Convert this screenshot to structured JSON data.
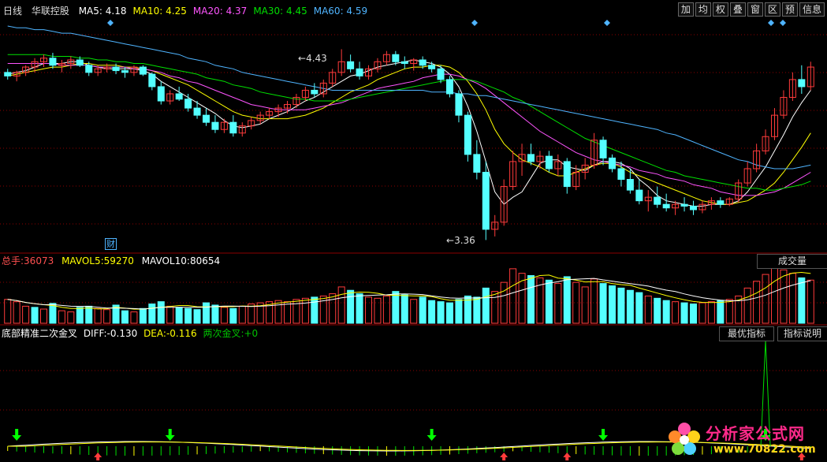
{
  "header": {
    "period": "日线",
    "stock_name": "华联控股",
    "ma": [
      {
        "label": "MA5:",
        "value": "4.18",
        "color": "#ffffff"
      },
      {
        "label": "MA10:",
        "value": "4.25",
        "color": "#ffff00"
      },
      {
        "label": "MA20:",
        "value": "4.37",
        "color": "#ff55ff"
      },
      {
        "label": "MA30:",
        "value": "4.45",
        "color": "#00e000"
      },
      {
        "label": "MA60:",
        "value": "4.59",
        "color": "#4fb4ff"
      }
    ],
    "buttons": [
      "加",
      "均",
      "权",
      "叠",
      "窗",
      "区",
      "预",
      "信息"
    ]
  },
  "annotations": {
    "high": "4.43",
    "low": "3.36",
    "fin_marker": "财"
  },
  "volume": {
    "label_total": "总手:",
    "total": "36073",
    "label_mavol5": "MAVOL5:",
    "mavol5": "59270",
    "label_mavol10": "MAVOL10:",
    "mavol10": "80654",
    "dropdown": "成交量"
  },
  "indicator": {
    "name": "底部精准二次金叉",
    "label_diff": "DIFF:",
    "diff": "-0.130",
    "label_dea": "DEA:",
    "dea": "-0.116",
    "label_cross": "两次金叉:",
    "cross": "+0",
    "btn_best": "最优指标",
    "btn_help": "指标说明"
  },
  "watermark": {
    "cn": "分析家公式网",
    "url": "www.70822.com"
  },
  "colors": {
    "up": "#ff3b3b",
    "down": "#54ffff",
    "bg": "#000000",
    "grid": "#8b0000"
  },
  "chart_data": {
    "type": "candlestick",
    "price_high": 4.43,
    "price_low": 3.36,
    "price_axis": [
      3.3,
      4.6
    ],
    "ohlc": [
      [
        4.3,
        4.32,
        4.26,
        4.28
      ],
      [
        4.28,
        4.31,
        4.25,
        4.3
      ],
      [
        4.3,
        4.34,
        4.28,
        4.33
      ],
      [
        4.33,
        4.38,
        4.3,
        4.36
      ],
      [
        4.36,
        4.4,
        4.33,
        4.38
      ],
      [
        4.38,
        4.41,
        4.32,
        4.34
      ],
      [
        4.34,
        4.37,
        4.3,
        4.35
      ],
      [
        4.35,
        4.39,
        4.32,
        4.37
      ],
      [
        4.37,
        4.39,
        4.33,
        4.34
      ],
      [
        4.34,
        4.36,
        4.28,
        4.3
      ],
      [
        4.3,
        4.34,
        4.28,
        4.32
      ],
      [
        4.32,
        4.35,
        4.3,
        4.33
      ],
      [
        4.33,
        4.35,
        4.29,
        4.31
      ],
      [
        4.31,
        4.33,
        4.27,
        4.3
      ],
      [
        4.3,
        4.34,
        4.28,
        4.33
      ],
      [
        4.33,
        4.34,
        4.28,
        4.29
      ],
      [
        4.29,
        4.3,
        4.2,
        4.22
      ],
      [
        4.22,
        4.25,
        4.12,
        4.14
      ],
      [
        4.14,
        4.2,
        4.12,
        4.18
      ],
      [
        4.18,
        4.22,
        4.14,
        4.15
      ],
      [
        4.15,
        4.18,
        4.08,
        4.1
      ],
      [
        4.1,
        4.14,
        4.04,
        4.06
      ],
      [
        4.06,
        4.1,
        4.0,
        4.02
      ],
      [
        4.02,
        4.06,
        3.96,
        3.98
      ],
      [
        3.98,
        4.04,
        3.96,
        4.02
      ],
      [
        4.02,
        4.06,
        3.94,
        3.96
      ],
      [
        3.96,
        4.02,
        3.94,
        4.0
      ],
      [
        4.0,
        4.05,
        3.98,
        4.03
      ],
      [
        4.03,
        4.08,
        4.01,
        4.06
      ],
      [
        4.06,
        4.1,
        4.04,
        4.08
      ],
      [
        4.08,
        4.12,
        4.05,
        4.1
      ],
      [
        4.1,
        4.14,
        4.07,
        4.12
      ],
      [
        4.12,
        4.18,
        4.1,
        4.16
      ],
      [
        4.16,
        4.22,
        4.14,
        4.2
      ],
      [
        4.2,
        4.24,
        4.16,
        4.18
      ],
      [
        4.18,
        4.26,
        4.16,
        4.24
      ],
      [
        4.24,
        4.32,
        4.22,
        4.3
      ],
      [
        4.3,
        4.43,
        4.28,
        4.36
      ],
      [
        4.36,
        4.4,
        4.3,
        4.32
      ],
      [
        4.32,
        4.36,
        4.26,
        4.28
      ],
      [
        4.28,
        4.34,
        4.26,
        4.32
      ],
      [
        4.32,
        4.38,
        4.3,
        4.36
      ],
      [
        4.36,
        4.42,
        4.34,
        4.4
      ],
      [
        4.4,
        4.42,
        4.34,
        4.36
      ],
      [
        4.36,
        4.39,
        4.32,
        4.35
      ],
      [
        4.35,
        4.38,
        4.31,
        4.37
      ],
      [
        4.37,
        4.39,
        4.32,
        4.34
      ],
      [
        4.34,
        4.36,
        4.3,
        4.32
      ],
      [
        4.32,
        4.34,
        4.24,
        4.26
      ],
      [
        4.26,
        4.28,
        4.16,
        4.18
      ],
      [
        4.18,
        4.2,
        4.02,
        4.06
      ],
      [
        4.06,
        4.08,
        3.8,
        3.84
      ],
      [
        3.84,
        3.92,
        3.7,
        3.74
      ],
      [
        3.74,
        3.8,
        3.36,
        3.42
      ],
      [
        3.42,
        3.5,
        3.38,
        3.46
      ],
      [
        3.46,
        3.7,
        3.44,
        3.66
      ],
      [
        3.66,
        3.86,
        3.64,
        3.8
      ],
      [
        3.8,
        3.9,
        3.72,
        3.84
      ],
      [
        3.84,
        3.9,
        3.78,
        3.8
      ],
      [
        3.8,
        3.86,
        3.76,
        3.83
      ],
      [
        3.83,
        3.86,
        3.74,
        3.76
      ],
      [
        3.76,
        3.84,
        3.72,
        3.8
      ],
      [
        3.8,
        3.82,
        3.62,
        3.66
      ],
      [
        3.66,
        3.78,
        3.64,
        3.74
      ],
      [
        3.74,
        3.82,
        3.7,
        3.78
      ],
      [
        3.78,
        3.96,
        3.76,
        3.92
      ],
      [
        3.92,
        3.94,
        3.78,
        3.82
      ],
      [
        3.82,
        3.84,
        3.74,
        3.76
      ],
      [
        3.76,
        3.8,
        3.66,
        3.7
      ],
      [
        3.7,
        3.76,
        3.62,
        3.64
      ],
      [
        3.64,
        3.7,
        3.56,
        3.58
      ],
      [
        3.58,
        3.64,
        3.52,
        3.6
      ],
      [
        3.6,
        3.66,
        3.54,
        3.56
      ],
      [
        3.56,
        3.62,
        3.52,
        3.54
      ],
      [
        3.54,
        3.58,
        3.5,
        3.56
      ],
      [
        3.56,
        3.6,
        3.52,
        3.55
      ],
      [
        3.55,
        3.58,
        3.5,
        3.53
      ],
      [
        3.53,
        3.58,
        3.51,
        3.56
      ],
      [
        3.56,
        3.6,
        3.53,
        3.58
      ],
      [
        3.58,
        3.6,
        3.54,
        3.56
      ],
      [
        3.56,
        3.6,
        3.55,
        3.59
      ],
      [
        3.59,
        3.7,
        3.57,
        3.68
      ],
      [
        3.68,
        3.8,
        3.66,
        3.76
      ],
      [
        3.76,
        3.9,
        3.74,
        3.86
      ],
      [
        3.86,
        3.98,
        3.84,
        3.94
      ],
      [
        3.94,
        4.1,
        3.92,
        4.06
      ],
      [
        4.06,
        4.2,
        4.04,
        4.16
      ],
      [
        4.16,
        4.3,
        4.14,
        4.26
      ],
      [
        4.26,
        4.34,
        4.18,
        4.22
      ],
      [
        4.22,
        4.36,
        4.2,
        4.33
      ]
    ],
    "ma_series": [
      {
        "name": "MA5",
        "color": "#ffffff",
        "values": [
          4.29,
          4.3,
          4.31,
          4.33,
          4.35,
          4.35,
          4.35,
          4.36,
          4.36,
          4.34,
          4.33,
          4.32,
          4.32,
          4.32,
          4.32,
          4.31,
          4.29,
          4.25,
          4.22,
          4.19,
          4.16,
          4.13,
          4.1,
          4.07,
          4.03,
          4.0,
          3.99,
          4.0,
          4.01,
          4.04,
          4.06,
          4.08,
          4.11,
          4.14,
          4.16,
          4.19,
          4.22,
          4.25,
          4.28,
          4.29,
          4.31,
          4.33,
          4.34,
          4.35,
          4.36,
          4.37,
          4.36,
          4.35,
          4.33,
          4.29,
          4.22,
          4.11,
          3.97,
          3.8,
          3.63,
          3.56,
          3.6,
          3.63,
          3.71,
          3.79,
          3.81,
          3.81,
          3.77,
          3.76,
          3.75,
          3.78,
          3.8,
          3.8,
          3.79,
          3.76,
          3.7,
          3.66,
          3.61,
          3.58,
          3.57,
          3.56,
          3.55,
          3.55,
          3.56,
          3.56,
          3.56,
          3.58,
          3.63,
          3.7,
          3.77,
          3.86,
          3.95,
          4.05,
          4.13,
          4.2
        ]
      },
      {
        "name": "MA10",
        "color": "#ffff00",
        "values": [
          4.28,
          4.29,
          4.3,
          4.31,
          4.32,
          4.33,
          4.33,
          4.34,
          4.35,
          4.35,
          4.34,
          4.34,
          4.34,
          4.33,
          4.33,
          4.32,
          4.31,
          4.29,
          4.27,
          4.25,
          4.23,
          4.2,
          4.17,
          4.14,
          4.11,
          4.08,
          4.06,
          4.05,
          4.04,
          4.04,
          4.04,
          4.04,
          4.05,
          4.06,
          4.08,
          4.1,
          4.13,
          4.16,
          4.19,
          4.21,
          4.23,
          4.26,
          4.28,
          4.3,
          4.32,
          4.33,
          4.33,
          4.34,
          4.34,
          4.33,
          4.3,
          4.25,
          4.18,
          4.09,
          3.98,
          3.9,
          3.85,
          3.81,
          3.79,
          3.77,
          3.74,
          3.72,
          3.72,
          3.74,
          3.76,
          3.78,
          3.79,
          3.79,
          3.77,
          3.74,
          3.72,
          3.7,
          3.68,
          3.66,
          3.64,
          3.62,
          3.6,
          3.58,
          3.57,
          3.56,
          3.56,
          3.57,
          3.58,
          3.61,
          3.64,
          3.68,
          3.74,
          3.81,
          3.88,
          3.96
        ]
      },
      {
        "name": "MA20",
        "color": "#ff55ff",
        "values": [
          4.35,
          4.35,
          4.35,
          4.35,
          4.35,
          4.35,
          4.34,
          4.34,
          4.34,
          4.34,
          4.33,
          4.33,
          4.33,
          4.33,
          4.32,
          4.32,
          4.31,
          4.3,
          4.28,
          4.27,
          4.25,
          4.24,
          4.22,
          4.2,
          4.18,
          4.16,
          4.14,
          4.12,
          4.11,
          4.1,
          4.09,
          4.09,
          4.09,
          4.09,
          4.1,
          4.11,
          4.12,
          4.13,
          4.15,
          4.17,
          4.19,
          4.21,
          4.22,
          4.23,
          4.24,
          4.25,
          4.27,
          4.28,
          4.29,
          4.29,
          4.28,
          4.26,
          4.24,
          4.21,
          4.17,
          4.13,
          4.09,
          4.05,
          4.01,
          3.97,
          3.94,
          3.91,
          3.88,
          3.85,
          3.83,
          3.81,
          3.8,
          3.79,
          3.78,
          3.77,
          3.75,
          3.74,
          3.73,
          3.71,
          3.7,
          3.69,
          3.67,
          3.66,
          3.65,
          3.63,
          3.62,
          3.61,
          3.61,
          3.61,
          3.62,
          3.63,
          3.65,
          3.68,
          3.71,
          3.74
        ]
      },
      {
        "name": "MA30",
        "color": "#00e000",
        "values": [
          4.4,
          4.4,
          4.4,
          4.4,
          4.4,
          4.39,
          4.39,
          4.39,
          4.38,
          4.38,
          4.37,
          4.37,
          4.36,
          4.36,
          4.35,
          4.35,
          4.34,
          4.33,
          4.32,
          4.31,
          4.3,
          4.29,
          4.27,
          4.26,
          4.25,
          4.23,
          4.22,
          4.21,
          4.19,
          4.18,
          4.17,
          4.16,
          4.15,
          4.15,
          4.14,
          4.14,
          4.14,
          4.14,
          4.15,
          4.16,
          4.17,
          4.18,
          4.19,
          4.2,
          4.21,
          4.22,
          4.23,
          4.24,
          4.25,
          4.26,
          4.26,
          4.26,
          4.25,
          4.23,
          4.21,
          4.19,
          4.16,
          4.14,
          4.11,
          4.08,
          4.05,
          4.02,
          3.99,
          3.96,
          3.93,
          3.91,
          3.89,
          3.87,
          3.85,
          3.83,
          3.81,
          3.79,
          3.77,
          3.75,
          3.74,
          3.72,
          3.71,
          3.7,
          3.69,
          3.68,
          3.67,
          3.66,
          3.65,
          3.65,
          3.64,
          3.64,
          3.65,
          3.66,
          3.67,
          3.69
        ]
      },
      {
        "name": "MA60",
        "color": "#4fb4ff",
        "values": [
          4.56,
          4.55,
          4.55,
          4.54,
          4.54,
          4.53,
          4.52,
          4.52,
          4.51,
          4.5,
          4.49,
          4.48,
          4.47,
          4.46,
          4.45,
          4.44,
          4.43,
          4.42,
          4.41,
          4.4,
          4.38,
          4.37,
          4.36,
          4.34,
          4.33,
          4.32,
          4.3,
          4.29,
          4.28,
          4.27,
          4.26,
          4.25,
          4.24,
          4.23,
          4.22,
          4.21,
          4.2,
          4.2,
          4.2,
          4.2,
          4.2,
          4.2,
          4.2,
          4.2,
          4.2,
          4.2,
          4.2,
          4.19,
          4.19,
          4.19,
          4.18,
          4.18,
          4.17,
          4.17,
          4.16,
          4.15,
          4.14,
          4.13,
          4.12,
          4.11,
          4.1,
          4.09,
          4.08,
          4.07,
          4.06,
          4.05,
          4.04,
          4.03,
          4.02,
          4.01,
          4.0,
          3.99,
          3.98,
          3.96,
          3.95,
          3.93,
          3.91,
          3.89,
          3.87,
          3.85,
          3.83,
          3.81,
          3.8,
          3.78,
          3.77,
          3.76,
          3.76,
          3.76,
          3.77,
          3.78
        ]
      }
    ],
    "volume_values": [
      42,
      38,
      30,
      28,
      25,
      35,
      22,
      20,
      28,
      30,
      26,
      24,
      32,
      22,
      20,
      26,
      34,
      38,
      30,
      28,
      26,
      24,
      36,
      32,
      28,
      26,
      30,
      34,
      36,
      38,
      40,
      38,
      42,
      44,
      46,
      48,
      52,
      64,
      58,
      52,
      46,
      44,
      48,
      56,
      50,
      42,
      46,
      40,
      38,
      36,
      42,
      48,
      46,
      62,
      56,
      72,
      96,
      88,
      84,
      80,
      76,
      70,
      82,
      72,
      64,
      78,
      70,
      66,
      62,
      58,
      54,
      48,
      44,
      40,
      38,
      36,
      34,
      36,
      38,
      40,
      42,
      48,
      62,
      74,
      86,
      100,
      94,
      88,
      80,
      76
    ],
    "volume_dirs": [
      1,
      1,
      1,
      0,
      1,
      0,
      1,
      1,
      0,
      0,
      1,
      1,
      0,
      0,
      1,
      0,
      0,
      0,
      1,
      0,
      0,
      0,
      0,
      0,
      1,
      0,
      1,
      1,
      1,
      1,
      1,
      1,
      1,
      1,
      0,
      1,
      1,
      1,
      0,
      0,
      1,
      1,
      1,
      0,
      0,
      1,
      0,
      0,
      0,
      0,
      0,
      0,
      0,
      0,
      1,
      1,
      1,
      1,
      0,
      1,
      0,
      1,
      0,
      1,
      1,
      1,
      0,
      0,
      0,
      0,
      0,
      1,
      0,
      0,
      1,
      0,
      0,
      1,
      1,
      0,
      1,
      1,
      1,
      1,
      1,
      1,
      1,
      1,
      0,
      1
    ],
    "indicator_spike_index": 84,
    "buy_arrow_indices": [
      1,
      18,
      47,
      66,
      84
    ],
    "sell_arrow_indices": [
      10,
      55,
      62,
      88
    ]
  }
}
